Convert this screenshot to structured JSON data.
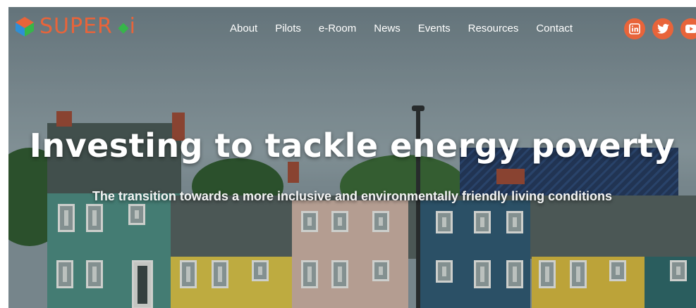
{
  "brand": {
    "name": "SUPER",
    "suffix": "i",
    "color": "#e8643a",
    "accent": "#37b54a"
  },
  "nav": {
    "items": [
      "About",
      "Pilots",
      "e-Room",
      "News",
      "Events",
      "Resources",
      "Contact"
    ]
  },
  "social": {
    "icons": [
      "linkedin-icon",
      "twitter-icon",
      "youtube-icon"
    ],
    "color": "#e8643a"
  },
  "hero": {
    "title": "Investing to tackle energy poverty",
    "subtitle": "The transition towards a more inclusive and environmentally friendly living conditions"
  }
}
